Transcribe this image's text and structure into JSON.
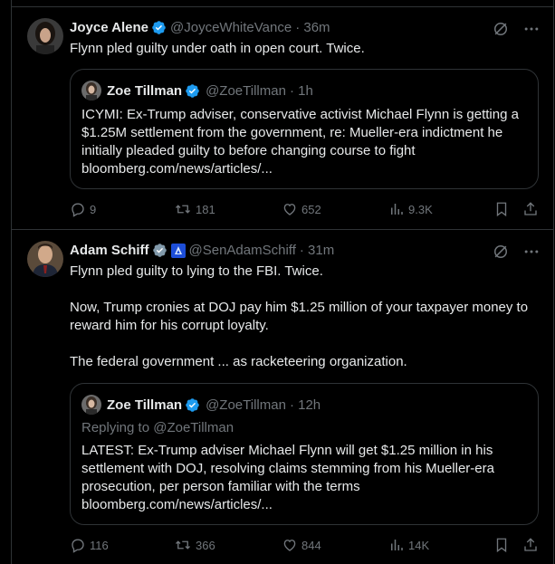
{
  "tweets": [
    {
      "name": "Joyce Alene",
      "handle": "@JoyceWhiteVance",
      "time": "· 36m",
      "paragraphs": [
        "Flynn pled guilty under oath in open court. Twice."
      ],
      "quote": {
        "name": "Zoe Tillman",
        "handle": "@ZoeTillman",
        "time": "· 1h",
        "replying": "",
        "text": "ICYMI: Ex-Trump adviser, conservative activist Michael Flynn is getting a $1.25M settlement from the government, re: Mueller-era indictment he initially pleaded guilty to before changing course to fight bloomberg.com/news/articles/..."
      },
      "actions": {
        "replies": "9",
        "reposts": "181",
        "likes": "652",
        "views": "9.3K"
      }
    },
    {
      "name": "Adam Schiff",
      "handle": "@SenAdamSchiff",
      "time": "· 31m",
      "paragraphs": [
        "Flynn pled guilty to lying to the FBI. Twice.",
        "Now, Trump cronies at DOJ pay him $1.25 million of your taxpayer money to reward him for his corrupt loyalty.",
        "The federal government ... as racketeering organization."
      ],
      "quote": {
        "name": "Zoe Tillman",
        "handle": "@ZoeTillman",
        "time": "· 12h",
        "replying": "Replying to @ZoeTillman",
        "text": "LATEST: Ex-Trump adviser Michael Flynn will get $1.25 million in his settlement with DOJ, resolving claims stemming from his Mueller-era prosecution, per person familiar with the terms bloomberg.com/news/articles/..."
      },
      "actions": {
        "replies": "116",
        "reposts": "366",
        "likes": "844",
        "views": "14K"
      }
    }
  ],
  "colors": {
    "background": "#000000",
    "text": "#e7e9ea",
    "muted": "#71767b",
    "border": "#2f3336",
    "verified": "#1d9bf0"
  },
  "icons": [
    "verified-badge-icon",
    "grok-icon",
    "more-icon",
    "reply-icon",
    "repost-icon",
    "like-icon",
    "views-icon",
    "bookmark-icon",
    "share-icon",
    "government-badge-icon"
  ]
}
